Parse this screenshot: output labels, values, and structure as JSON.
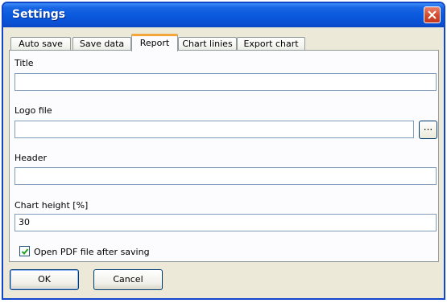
{
  "window": {
    "title": "Settings"
  },
  "tabs": [
    {
      "label": "Auto save"
    },
    {
      "label": "Save data"
    },
    {
      "label": "Report",
      "active": true
    },
    {
      "label": "Chart linies"
    },
    {
      "label": "Export chart"
    }
  ],
  "report": {
    "title_label": "Title",
    "title_value": "",
    "logo_label": "Logo file",
    "logo_value": "",
    "browse_label": "...",
    "header_label": "Header",
    "header_value": "",
    "chart_height_label": "Chart height [%]",
    "chart_height_value": "30",
    "open_pdf_label": "Open PDF file after saving",
    "open_pdf_checked": true
  },
  "buttons": {
    "ok": "OK",
    "cancel": "Cancel"
  },
  "colors": {
    "titlebar": "#0a58dc",
    "close": "#d34a2e",
    "active_tab_accent": "#f3a63a"
  }
}
